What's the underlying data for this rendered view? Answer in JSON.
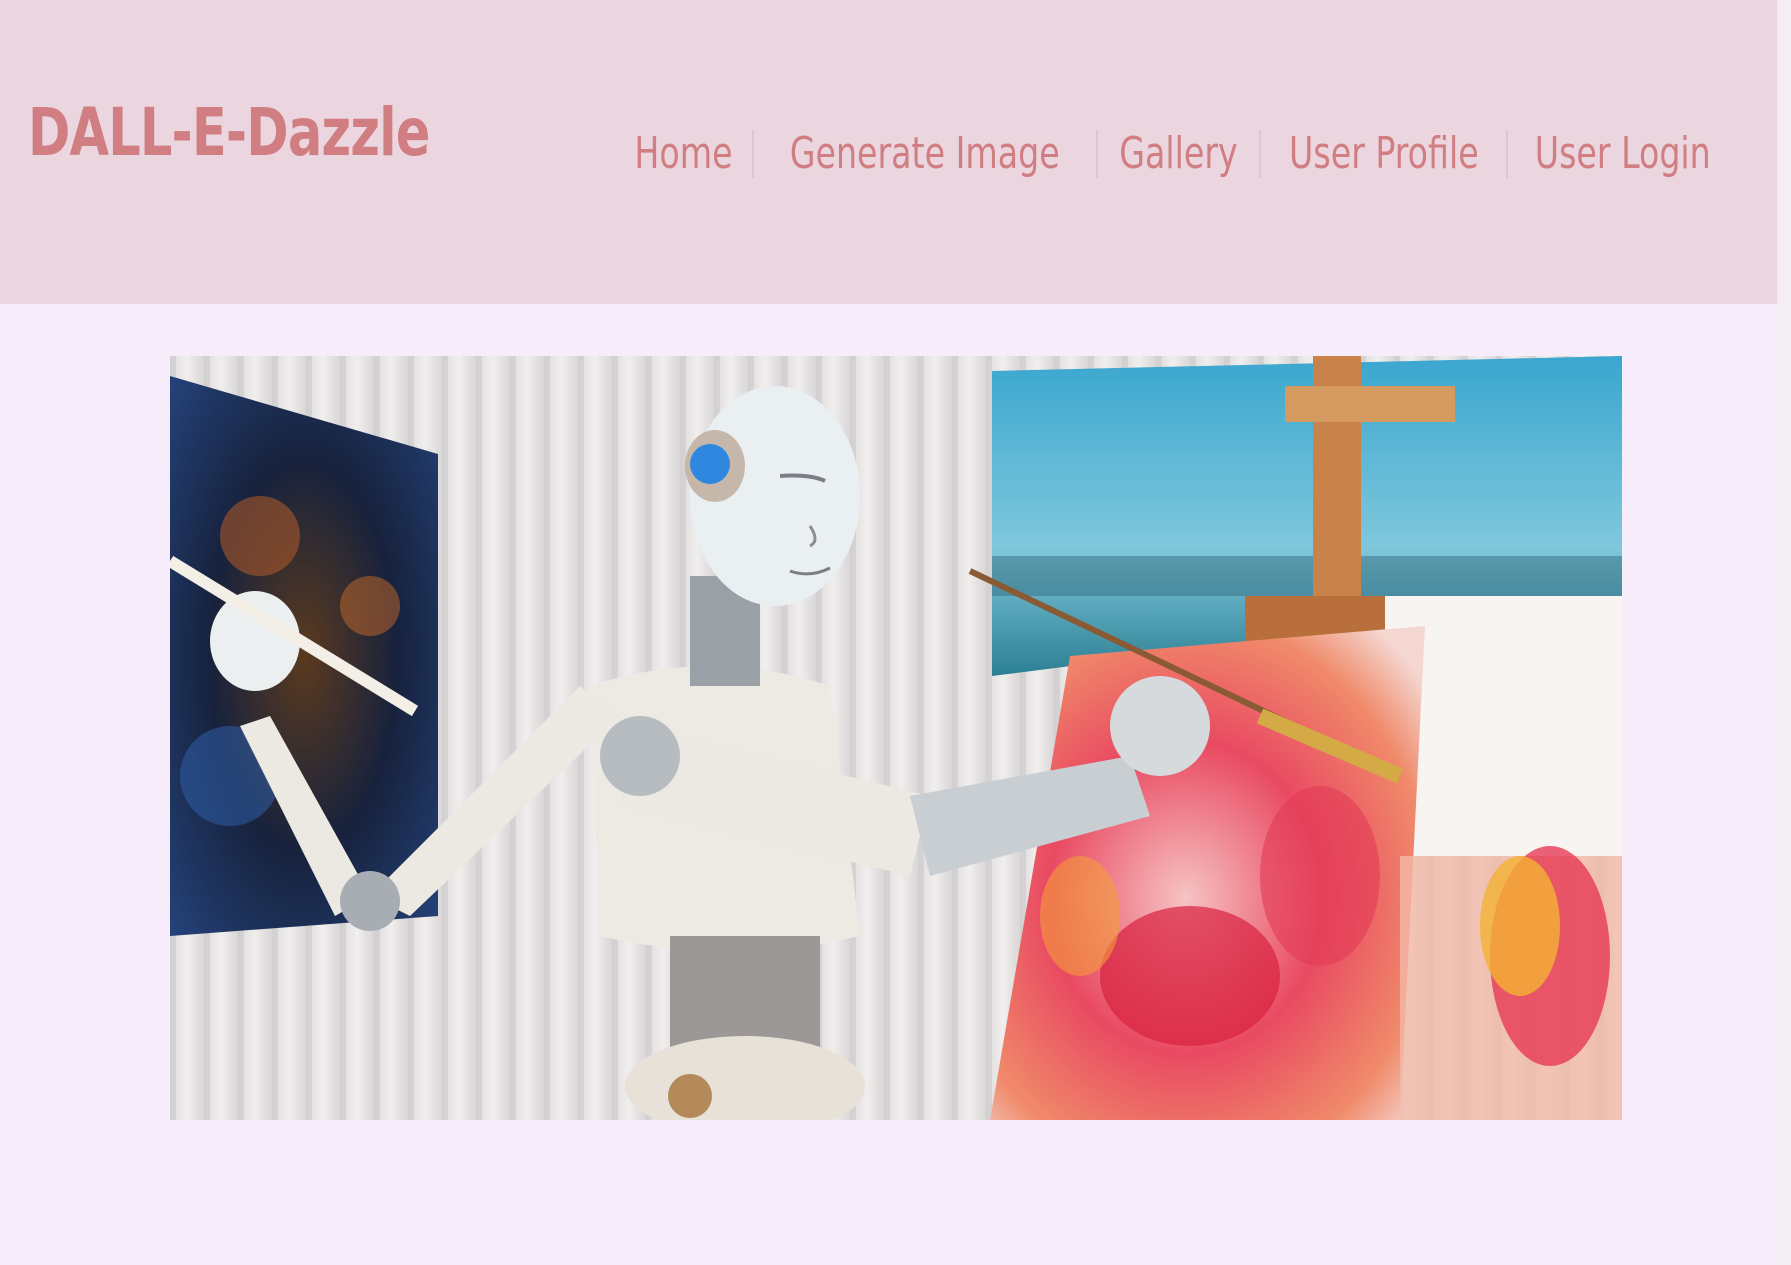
{
  "brand": {
    "title": "DALL-E-Dazzle"
  },
  "nav": {
    "items": [
      {
        "label": "Home"
      },
      {
        "label": "Generate Image"
      },
      {
        "label": "Gallery"
      },
      {
        "label": "User Profile"
      },
      {
        "label": "User Login"
      }
    ]
  },
  "hero": {
    "image_subject": "robot-painting-artwork",
    "colors": {
      "curtain": "#e8e6e6",
      "left_painting": "#1d2a4a",
      "canvas_sky": "#4fb5d6",
      "canvas_paint": "#e94a62",
      "robot_body": "#eeebe7",
      "easel": "#c9834a"
    }
  },
  "theme": {
    "header_bg": "#ebd6df",
    "page_bg": "#f6ecfa",
    "accent": "#d17e82"
  }
}
